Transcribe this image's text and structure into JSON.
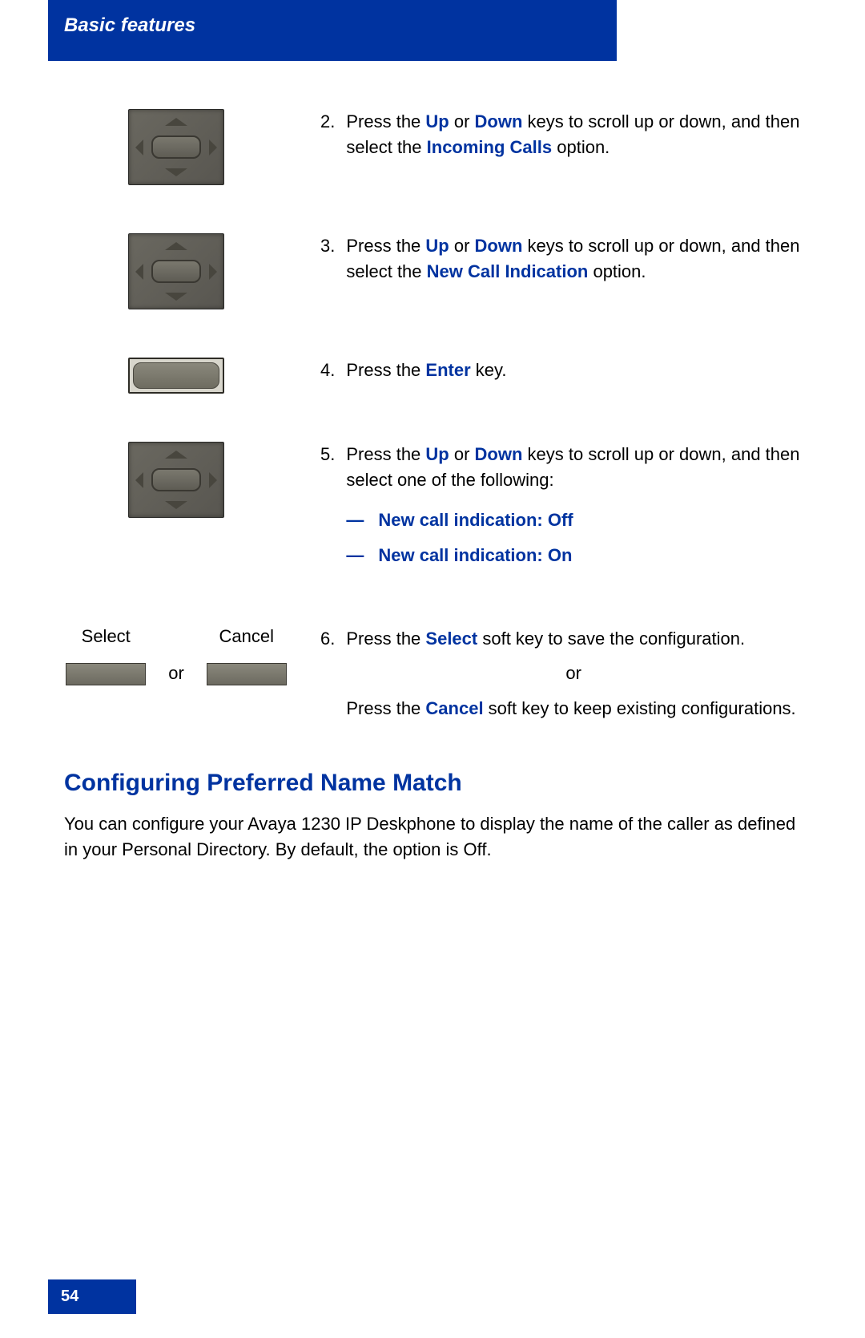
{
  "header": {
    "title": "Basic features"
  },
  "steps": [
    {
      "num": "2.",
      "parts": [
        {
          "t": "Press the "
        },
        {
          "t": "Up",
          "kw": true
        },
        {
          "t": " or "
        },
        {
          "t": "Down",
          "kw": true
        },
        {
          "t": " keys to scroll up or down, and then select the "
        },
        {
          "t": "Incoming Calls",
          "kw": true
        },
        {
          "t": " option."
        }
      ]
    },
    {
      "num": "3.",
      "parts": [
        {
          "t": "Press the "
        },
        {
          "t": "Up",
          "kw": true
        },
        {
          "t": " or "
        },
        {
          "t": "Down",
          "kw": true
        },
        {
          "t": " keys to scroll up or down, and then select the "
        },
        {
          "t": "New Call Indication",
          "kw": true
        },
        {
          "t": " option."
        }
      ]
    },
    {
      "num": "4.",
      "parts": [
        {
          "t": "Press the "
        },
        {
          "t": "Enter",
          "kw": true
        },
        {
          "t": " key."
        }
      ]
    },
    {
      "num": "5.",
      "parts": [
        {
          "t": "Press the "
        },
        {
          "t": "Up",
          "kw": true
        },
        {
          "t": " or "
        },
        {
          "t": "Down",
          "kw": true
        },
        {
          "t": " keys to scroll up or down, and then select one of the following:"
        }
      ],
      "sublist": [
        "New call indication: Off",
        "New call indication: On"
      ]
    },
    {
      "num": "6.",
      "top_parts": [
        {
          "t": "Press the "
        },
        {
          "t": "Select",
          "kw": true
        },
        {
          "t": " soft key to save the configuration."
        }
      ],
      "or": "or",
      "bottom_parts": [
        {
          "t": "Press the "
        },
        {
          "t": "Cancel",
          "kw": true
        },
        {
          "t": " soft key to keep existing configurations."
        }
      ]
    }
  ],
  "softkeys": {
    "select": "Select",
    "cancel": "Cancel",
    "or": "or"
  },
  "section": {
    "heading": "Configuring Preferred Name Match",
    "para": "You can configure your Avaya 1230 IP Deskphone to display the name of the caller as defined in your Personal Directory. By default, the option is Off."
  },
  "footer": {
    "page": "54"
  },
  "sublist_dash": "—"
}
